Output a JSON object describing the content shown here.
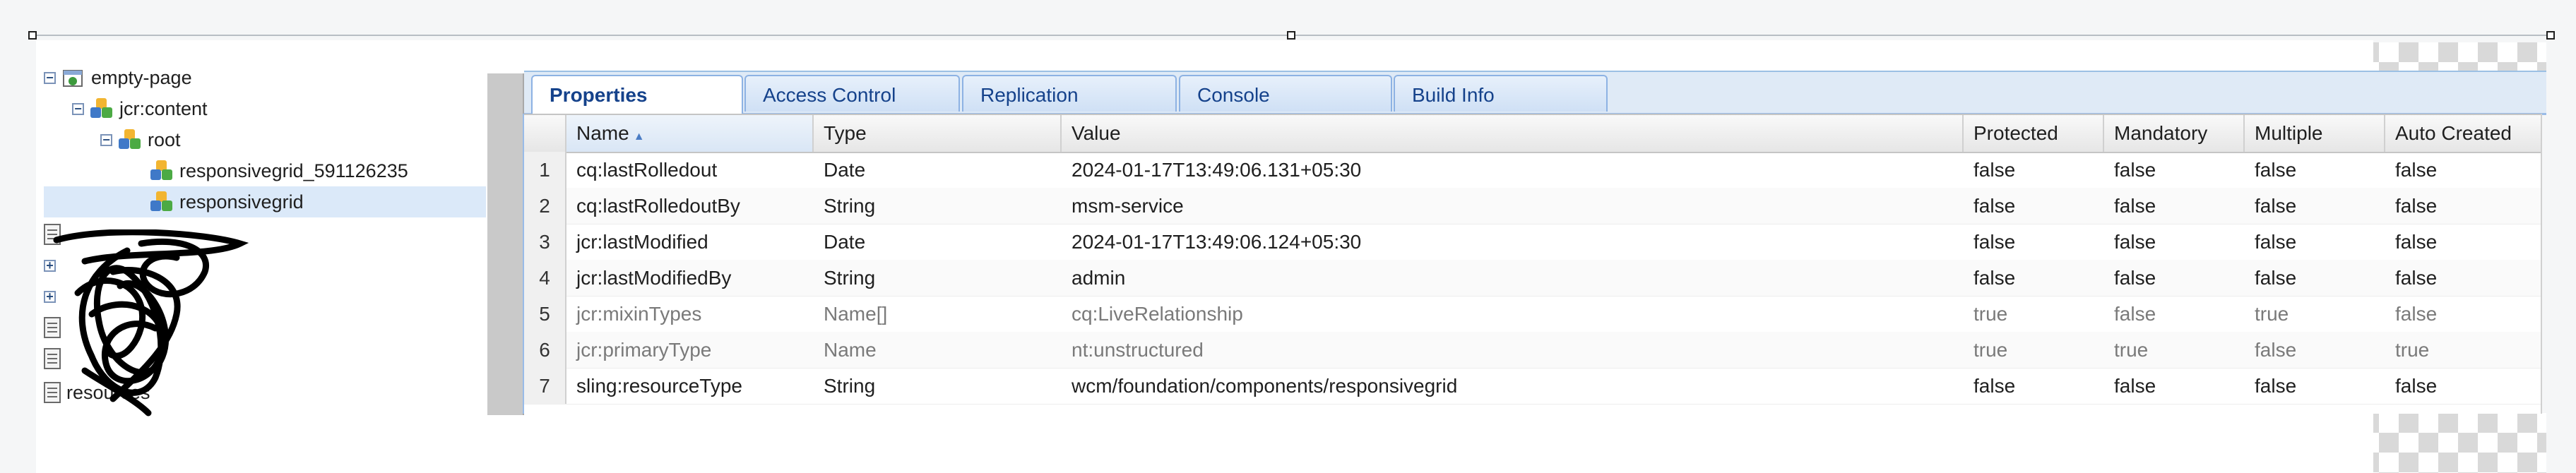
{
  "tree": {
    "nodes": [
      {
        "label": "empty-page",
        "expander": "−"
      },
      {
        "label": "jcr:content",
        "expander": "−"
      },
      {
        "label": "root",
        "expander": "−"
      },
      {
        "label": "responsivegrid_591126235"
      },
      {
        "label": "responsivegrid"
      }
    ],
    "partial_nodes": [
      {
        "label": "resources"
      }
    ]
  },
  "tabs": [
    "Properties",
    "Access Control",
    "Replication",
    "Console",
    "Build Info"
  ],
  "active_tab": "Properties",
  "grid": {
    "columns": [
      "Name",
      "Type",
      "Value",
      "Protected",
      "Mandatory",
      "Multiple",
      "Auto Created"
    ],
    "sort_column": "Name",
    "sort_icon": "sort-ascending-icon",
    "rows": [
      {
        "num": "1",
        "name": "cq:lastRolledout",
        "type": "Date",
        "value": "2024-01-17T13:49:06.131+05:30",
        "protected": "false",
        "mandatory": "false",
        "multiple": "false",
        "auto_created": "false"
      },
      {
        "num": "2",
        "name": "cq:lastRolledoutBy",
        "type": "String",
        "value": "msm-service",
        "protected": "false",
        "mandatory": "false",
        "multiple": "false",
        "auto_created": "false"
      },
      {
        "num": "3",
        "name": "jcr:lastModified",
        "type": "Date",
        "value": "2024-01-17T13:49:06.124+05:30",
        "protected": "false",
        "mandatory": "false",
        "multiple": "false",
        "auto_created": "false"
      },
      {
        "num": "4",
        "name": "jcr:lastModifiedBy",
        "type": "String",
        "value": "admin",
        "protected": "false",
        "mandatory": "false",
        "multiple": "false",
        "auto_created": "false"
      },
      {
        "num": "5",
        "name": "jcr:mixinTypes",
        "type": "Name[]",
        "value": "cq:LiveRelationship",
        "protected": "true",
        "mandatory": "false",
        "multiple": "true",
        "auto_created": "false"
      },
      {
        "num": "6",
        "name": "jcr:primaryType",
        "type": "Name",
        "value": "nt:unstructured",
        "protected": "true",
        "mandatory": "true",
        "multiple": "false",
        "auto_created": "true"
      },
      {
        "num": "7",
        "name": "sling:resourceType",
        "type": "String",
        "value": "wcm/foundation/components/responsivegrid",
        "protected": "false",
        "mandatory": "false",
        "multiple": "false",
        "auto_created": "false"
      }
    ]
  },
  "colors": {
    "tab_text": "#15428b",
    "selection": "#dbe9f9",
    "muted_text": "#7a7a7a"
  }
}
